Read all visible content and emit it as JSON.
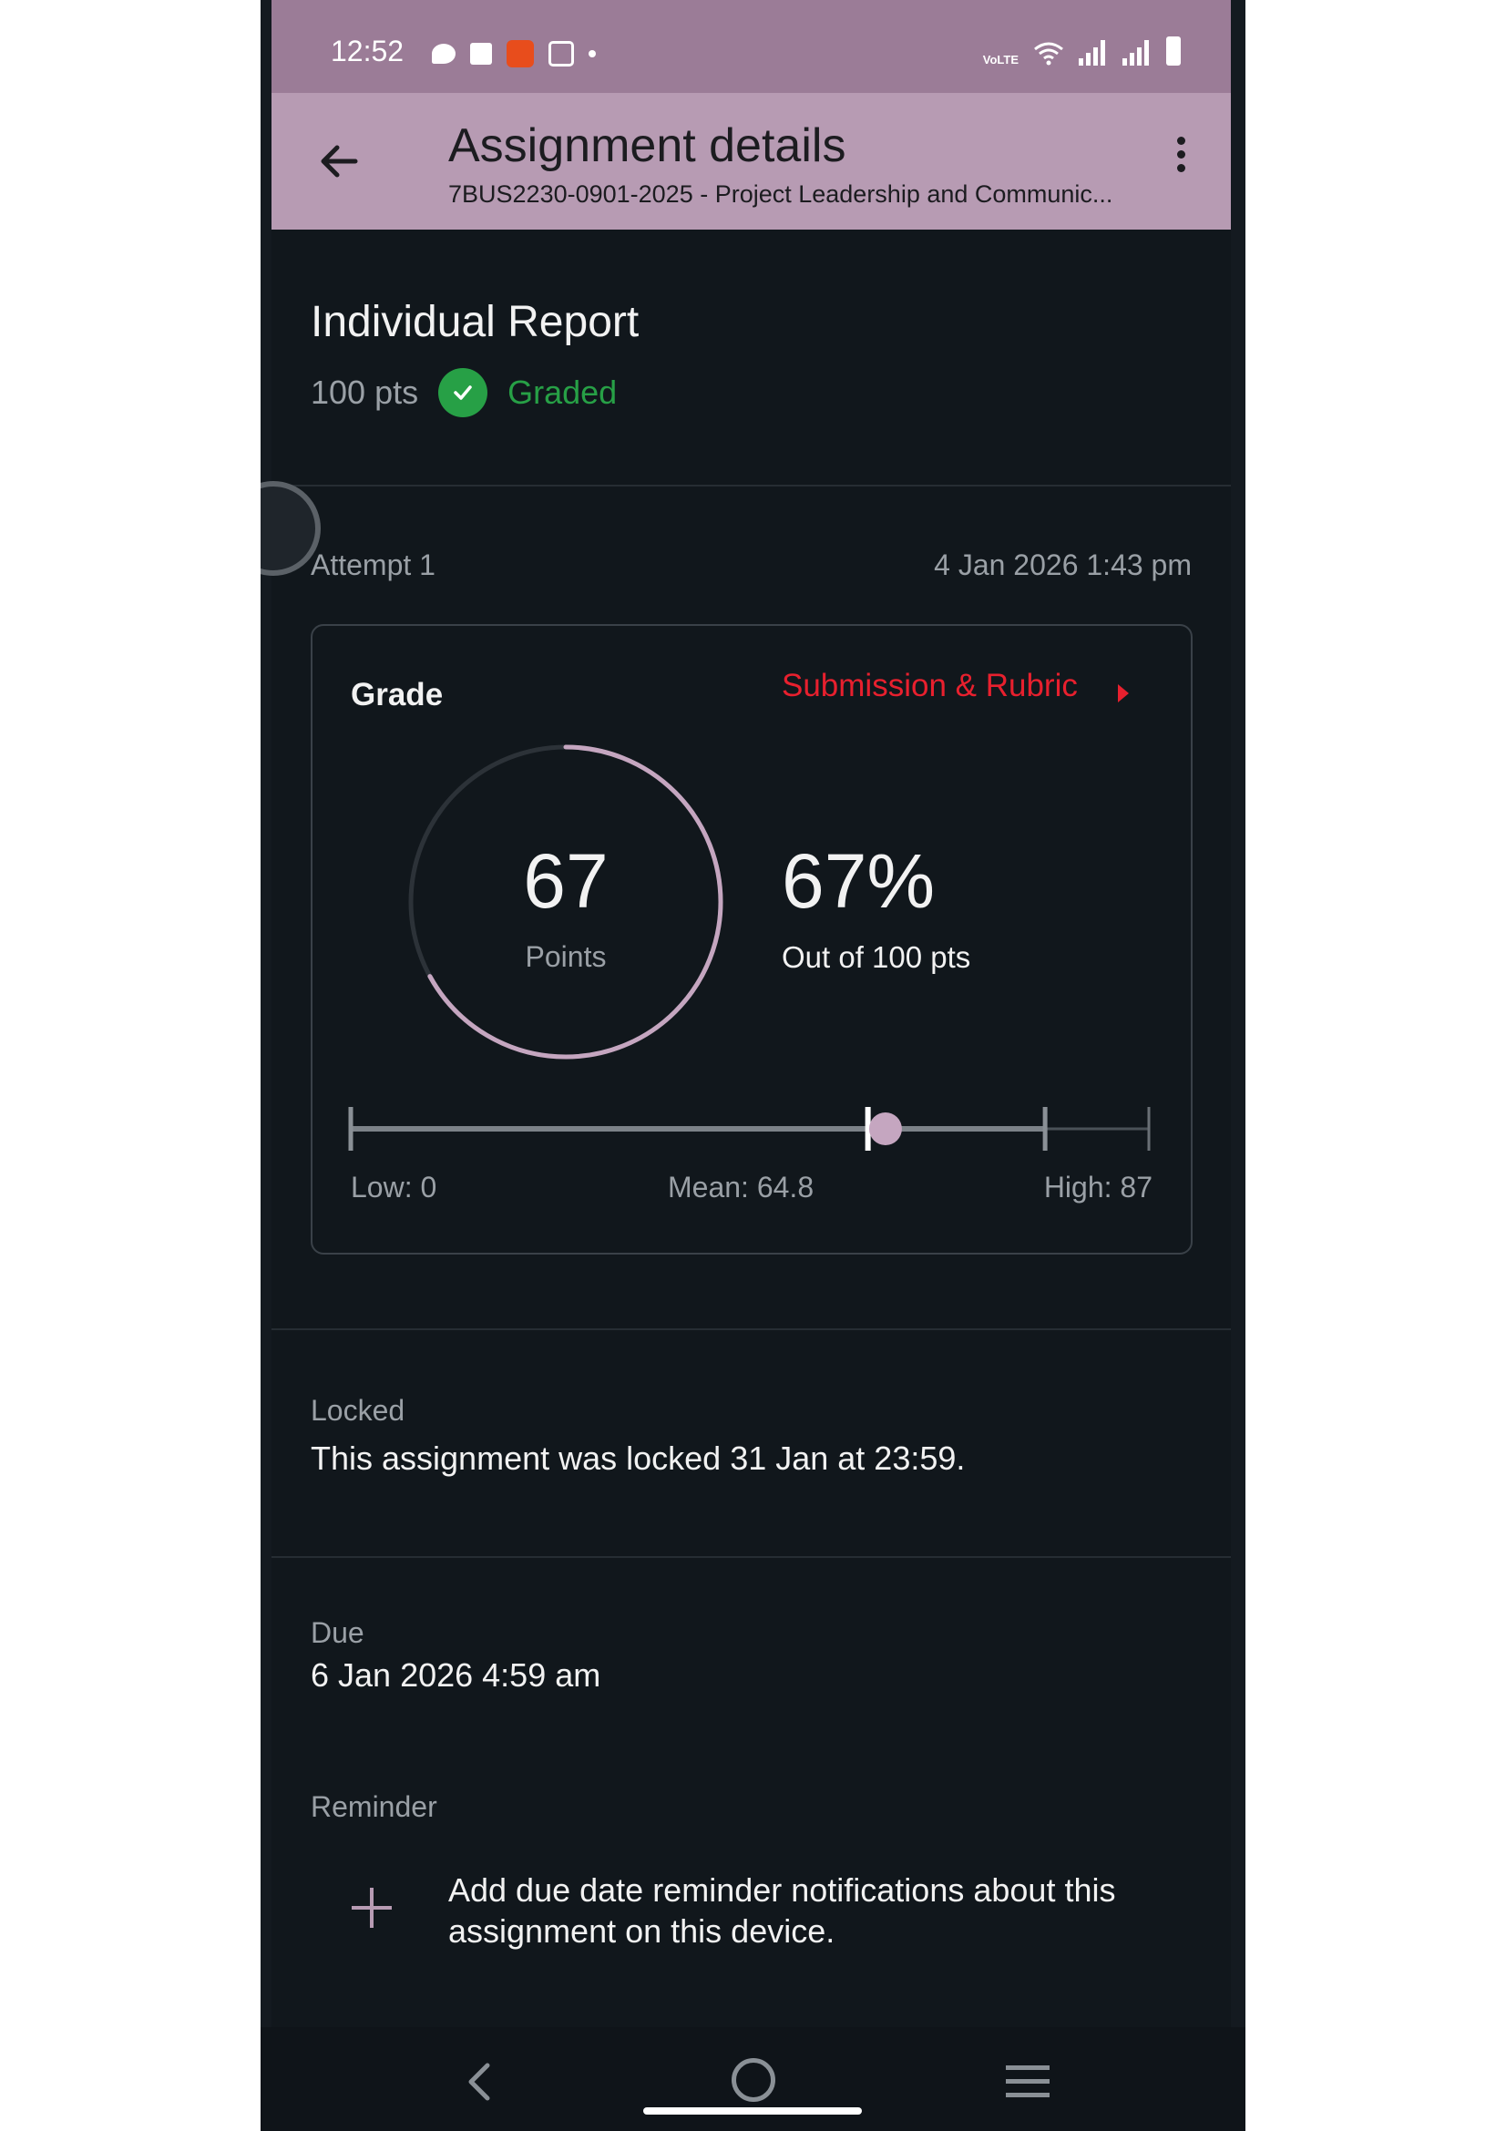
{
  "status_bar": {
    "time": "12:52",
    "volte": "VoLTE",
    "colors": {
      "background": "#9b7c97"
    }
  },
  "app_bar": {
    "title": "Assignment details",
    "subtitle": "7BUS2230-0901-2025 - Project Leadership and Communic...",
    "colors": {
      "background": "#b79bb3"
    }
  },
  "assignment": {
    "title": "Individual Report",
    "points": "100 pts",
    "status": "Graded",
    "status_color": "#27a046"
  },
  "attempt": {
    "label": "Attempt 1",
    "date": "4 Jan 2026 1:43 pm"
  },
  "grade": {
    "label": "Grade",
    "link": "Submission & Rubric",
    "link_color": "#e8202e",
    "score": "67",
    "score_label": "Points",
    "score_fraction": 0.67,
    "percent": "67%",
    "out_of": "Out of 100 pts",
    "range": {
      "low_label": "Low: 0",
      "mean_label": "Mean: 64.8",
      "high_label": "High: 87",
      "low": 0,
      "mean": 64.8,
      "high": 87,
      "score": 67,
      "max": 100
    }
  },
  "locked": {
    "label": "Locked",
    "text": "This assignment was locked 31 Jan at 23:59."
  },
  "due": {
    "label": "Due",
    "date": "6 Jan 2026 4:59 am"
  },
  "reminder": {
    "label": "Reminder",
    "text": "Add due date reminder notifications about this assignment on this device."
  },
  "accent_color": "#b79bb3"
}
